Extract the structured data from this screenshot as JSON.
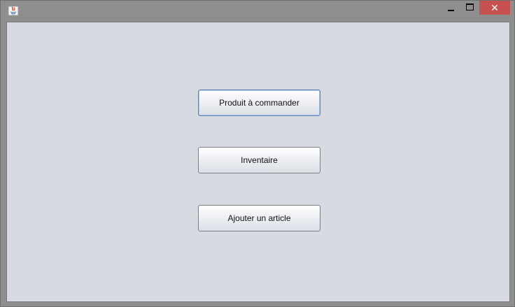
{
  "window": {
    "controls": {
      "minimize_icon": "minimize-icon",
      "maximize_icon": "maximize-icon",
      "close_label": "✕"
    },
    "accent_close": "#c75050",
    "background": "#d8dae1"
  },
  "main": {
    "buttons": [
      {
        "label": "Produit à commander",
        "focused": true
      },
      {
        "label": "Inventaire",
        "focused": false
      },
      {
        "label": "Ajouter un article",
        "focused": false
      }
    ]
  }
}
